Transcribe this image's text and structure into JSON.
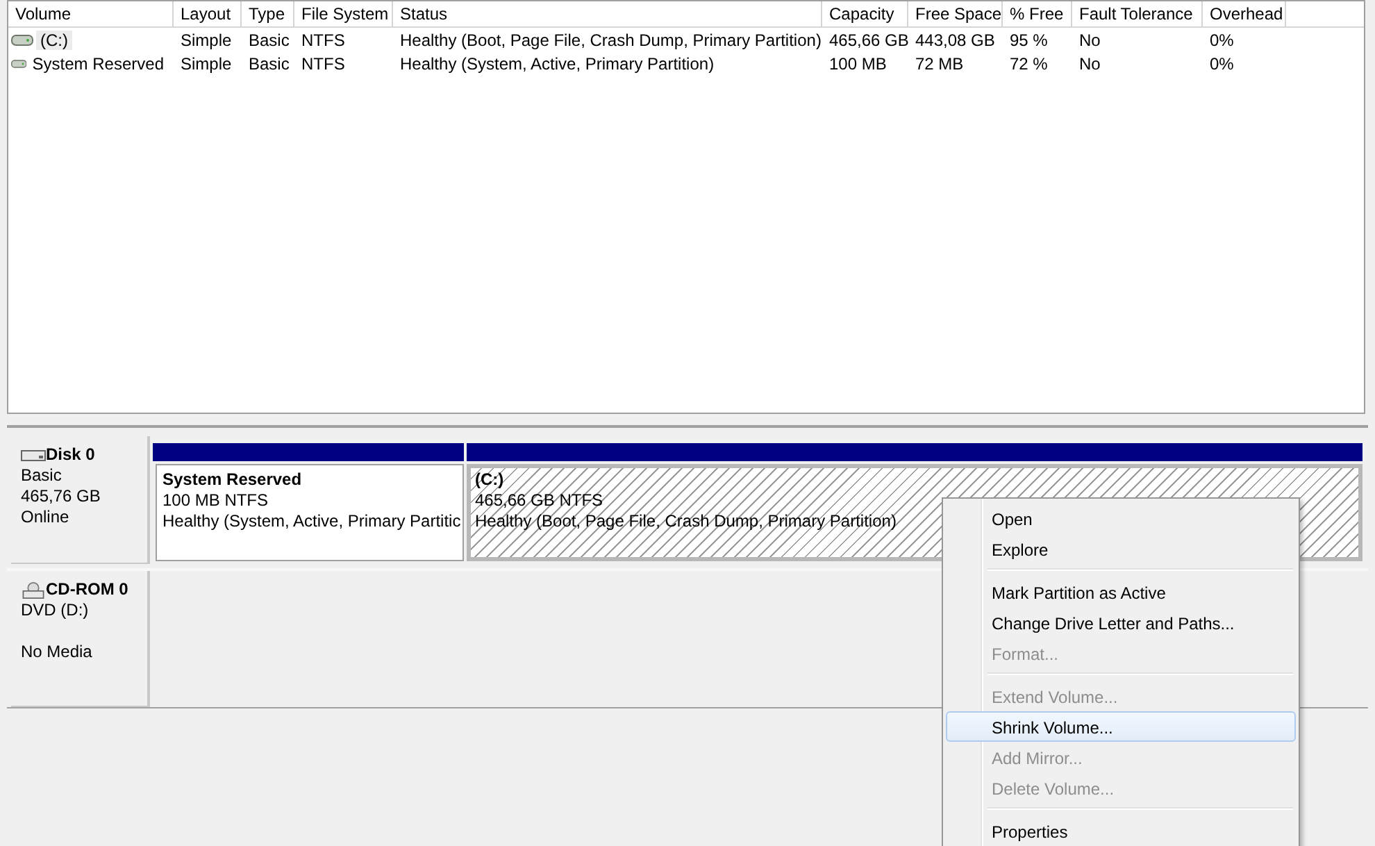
{
  "volume_list": {
    "columns": [
      "Volume",
      "Layout",
      "Type",
      "File System",
      "Status",
      "Capacity",
      "Free Space",
      "% Free",
      "Fault Tolerance",
      "Overhead"
    ],
    "rows": [
      {
        "selected": true,
        "cells": [
          "(C:)",
          "Simple",
          "Basic",
          "NTFS",
          "Healthy (Boot, Page File, Crash Dump, Primary Partition)",
          "465,66 GB",
          "443,08 GB",
          "95 %",
          "No",
          "0%"
        ]
      },
      {
        "selected": false,
        "cells": [
          "System Reserved",
          "Simple",
          "Basic",
          "NTFS",
          "Healthy (System, Active, Primary Partition)",
          "100 MB",
          "72 MB",
          "72 %",
          "No",
          "0%"
        ]
      }
    ]
  },
  "disks": [
    {
      "kind": "disk",
      "name": "Disk 0",
      "lines": [
        "Basic",
        "465,76 GB",
        "Online"
      ],
      "partitions": [
        {
          "name": "System Reserved",
          "size": "100 MB NTFS",
          "status": "Healthy (System, Active, Primary Partitic",
          "selected": false
        },
        {
          "name": "(C:)",
          "size": "465,66 GB NTFS",
          "status": "Healthy (Boot, Page File, Crash Dump, Primary Partition)",
          "selected": true
        }
      ]
    },
    {
      "kind": "cdrom",
      "name": "CD-ROM 0",
      "lines": [
        "DVD (D:)",
        "No Media"
      ]
    }
  ],
  "context_menu": [
    {
      "kind": "item",
      "label": "Open",
      "disabled": false,
      "selected": false
    },
    {
      "kind": "item",
      "label": "Explore",
      "disabled": false,
      "selected": false
    },
    {
      "kind": "separator"
    },
    {
      "kind": "item",
      "label": "Mark Partition as Active",
      "disabled": false,
      "selected": false
    },
    {
      "kind": "item",
      "label": "Change Drive Letter and Paths...",
      "disabled": false,
      "selected": false
    },
    {
      "kind": "item",
      "label": "Format...",
      "disabled": true,
      "selected": false
    },
    {
      "kind": "separator"
    },
    {
      "kind": "item",
      "label": "Extend Volume...",
      "disabled": true,
      "selected": false
    },
    {
      "kind": "item",
      "label": "Shrink Volume...",
      "disabled": false,
      "selected": true
    },
    {
      "kind": "item",
      "label": "Add Mirror...",
      "disabled": true,
      "selected": false
    },
    {
      "kind": "item",
      "label": "Delete Volume...",
      "disabled": true,
      "selected": false
    },
    {
      "kind": "separator"
    },
    {
      "kind": "item",
      "label": "Properties",
      "disabled": false,
      "selected": false
    }
  ]
}
